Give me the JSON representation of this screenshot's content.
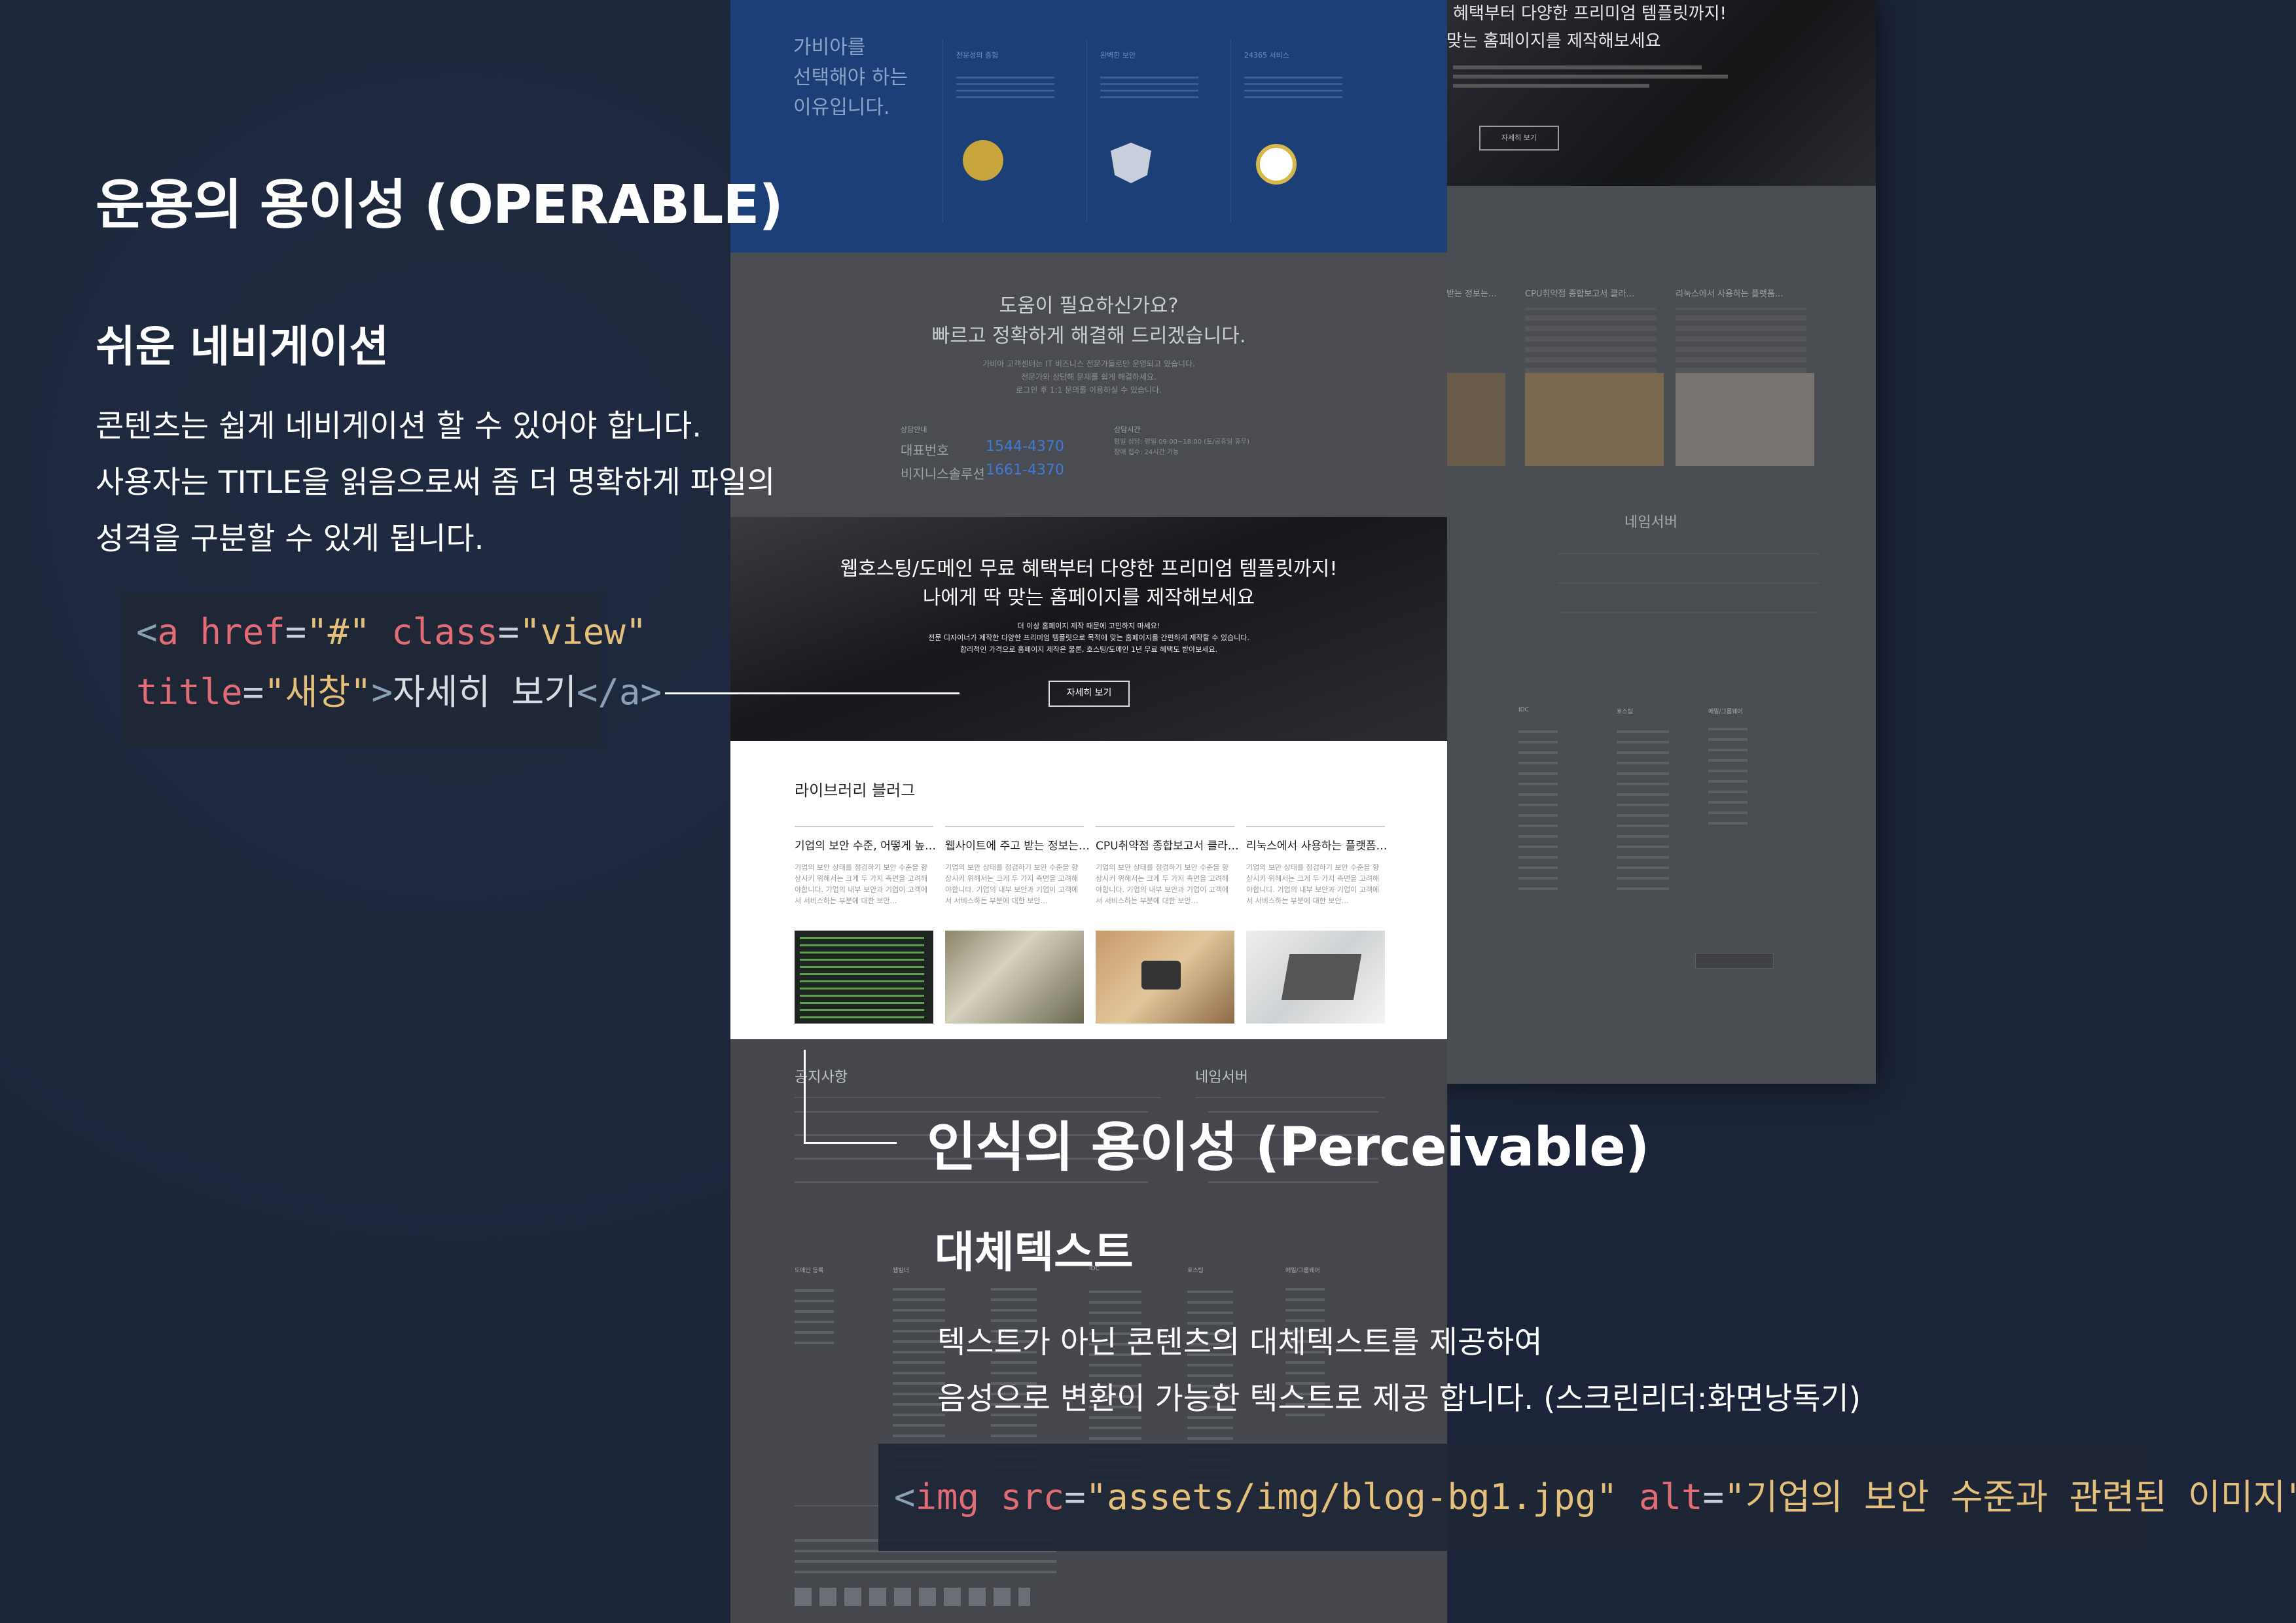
{
  "operable": {
    "title": "운용의 용이성 (OPERABLE)",
    "subtitle": "쉬운 네비게이션",
    "lines": [
      "콘텐츠는 쉽게 네비게이션 할 수 있어야 합니다.",
      "사용자는 TITLE을 읽음으로써 좀 더 명확하게 파일의",
      "성격을 구분할 수 있게 됩니다."
    ],
    "code": {
      "open": "<",
      "tag": "a",
      "attr1": "href",
      "val1": "\"#\"",
      "attr2": "class",
      "val2": "\"view\"",
      "attr3": "title",
      "val3": "\"새창\"",
      "text": "자세히 보기",
      "close": "</a>"
    }
  },
  "perceivable": {
    "title": "인식의 용이성 (Perceivable)",
    "subtitle": "대체텍스트",
    "lines": [
      "텍스트가 아닌 콘텐츠의 대체텍스트를 제공하여",
      "음성으로 변환이 가능한 텍스트로 제공 합니다. (스크린리더:화면낭독기)"
    ],
    "code": {
      "tag": "img",
      "attr1": "src",
      "val1": "\"assets/img/blog-bg1.jpg\"",
      "attr2": "alt",
      "val2": "\"기업의 보안 수준과 관련된 이미지\""
    }
  },
  "mock": {
    "why": [
      "가비아를",
      "선택해야 하는",
      "이유입니다."
    ],
    "features": [
      "전문성의 증험",
      "완벽한 보안",
      "24365 서비스"
    ],
    "help_title": "도움이 필요하신가요?",
    "help_sub": "빠르고 정확하게 해결해 드리겠습니다.",
    "help_desc": [
      "가비아 고객센터는 IT 비즈니스 전문가들로만 운영되고 있습니다.",
      "전문가와 상담해 문제를 쉽게 해결하세요.",
      "로그인 후 1:1 문의를 이용하실 수 있습니다."
    ],
    "contact_label": "상담안내",
    "contact_rows": [
      {
        "k": "대표번호",
        "v": "1544-4370"
      },
      {
        "k": "비지니스솔루션",
        "v": "1661-4370"
      }
    ],
    "hours_label": "상담시간",
    "hours": [
      "평일 상담: 평일 09:00~18:00 (토/공휴일 휴무)",
      "장애 접수: 24시간 가능"
    ],
    "banner_title": "웹호스팅/도메인 무료 혜택부터 다양한 프리미엄 템플릿까지!",
    "banner_sub": "나에게 딱 맞는 홈페이지를 제작해보세요",
    "banner_desc": [
      "더 이상 홈페이지 제작 때문에 고민하지 마세요!",
      "전문 디자이너가 제작한 다양한 프리미엄 템플릿으로 목적에 맞는 홈페이지를 간편하게 제작할 수 있습니다.",
      "합리적인 가격으로 홈페이지 제작은 물론, 호스팅/도메인 1년 무료 혜택도 받아보세요."
    ],
    "banner_button": "자세히 보기",
    "library_title": "라이브러리 블러그",
    "posts": [
      {
        "title": "기업의 보안 수준, 어떻게 높…",
        "body": "기업의 보안 상태를 점검하기 보안 수준을 향상시키 위해서는 크게 두 가지 측면을 고려해야합니다. 기업의 내부 보안과 기업이 고객에서 서비스하는 부분에 대한 보안…"
      },
      {
        "title": "웹사이트에 주고 받는 정보는…",
        "body": "기업의 보안 상태를 점검하기 보안 수준을 향상시키 위해서는 크게 두 가지 측면을 고려해야합니다. 기업의 내부 보안과 기업이 고객에서 서비스하는 부분에 대한 보안…"
      },
      {
        "title": "CPU취약점 종합보고서 클라…",
        "body": "기업의 보안 상태를 점검하기 보안 수준을 향상시키 위해서는 크게 두 가지 측면을 고려해야합니다. 기업의 내부 보안과 기업이 고객에서 서비스하는 부분에 대한 보안…"
      },
      {
        "title": "리눅스에서 사용하는 플랫폼…",
        "body": "기업의 보안 상태를 점검하기 보안 수준을 향상시키 위해서는 크게 두 가지 측면을 고려해야합니다. 기업의 내부 보안과 기업이 고객에서 서비스하는 부분에 대한 보안…"
      }
    ],
    "notice": "공지사항",
    "nameserver": "네임서버",
    "right_top_title": "혜택부터 다양한 프리미엄 템플릿까지!",
    "right_top_sub": "맞는 홈페이지를 제작해보세요",
    "right_button": "자세히 보기",
    "right_posts": [
      "받는 정보는…",
      "CPU취약점 종합보고서 클라…",
      "리눅스에서 사용하는 플랫폼…"
    ],
    "footer_cols": [
      "도메인 등록",
      "웹빌더",
      "IDC",
      "호스팅",
      "메일/그룹웨어"
    ]
  },
  "colors": {
    "bg": "#1b2438",
    "accent_blue": "#1c3f78",
    "phone": "#3d7bd6"
  }
}
